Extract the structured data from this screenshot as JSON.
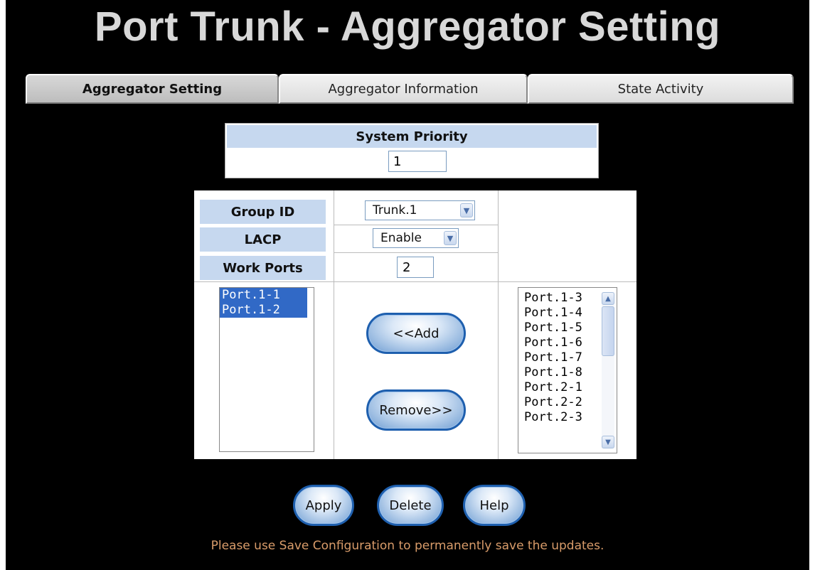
{
  "page": {
    "title": "Port Trunk - Aggregator Setting",
    "note": "Please use Save Configuration to permanently save the updates."
  },
  "tabs": [
    {
      "label": "Aggregator Setting",
      "active": true
    },
    {
      "label": "Aggregator Information",
      "active": false
    },
    {
      "label": "State Activity",
      "active": false
    }
  ],
  "system_priority": {
    "label": "System Priority",
    "value": "1"
  },
  "group": {
    "group_id_label": "Group ID",
    "group_id_value": "Trunk.1",
    "lacp_label": "LACP",
    "lacp_value": "Enable",
    "work_ports_label": "Work Ports",
    "work_ports_value": "2"
  },
  "member_ports": [
    "Port.1-1",
    "Port.1-2"
  ],
  "available_ports": [
    "Port.1-3",
    "Port.1-4",
    "Port.1-5",
    "Port.1-6",
    "Port.1-7",
    "Port.1-8",
    "Port.2-1",
    "Port.2-2",
    "Port.2-3"
  ],
  "buttons": {
    "add": "<<Add",
    "remove": "Remove>>",
    "apply": "Apply",
    "delete": "Delete",
    "help": "Help"
  },
  "icons": {
    "select_arrow": "chevron-down-icon",
    "scroll_up": "chevron-up-icon",
    "scroll_down": "chevron-down-icon"
  },
  "colors": {
    "header_bg": "#c6d8ef",
    "selected_item": "#3169c6",
    "note_text": "#d99c6a",
    "title_text": "#d8d8d8"
  }
}
